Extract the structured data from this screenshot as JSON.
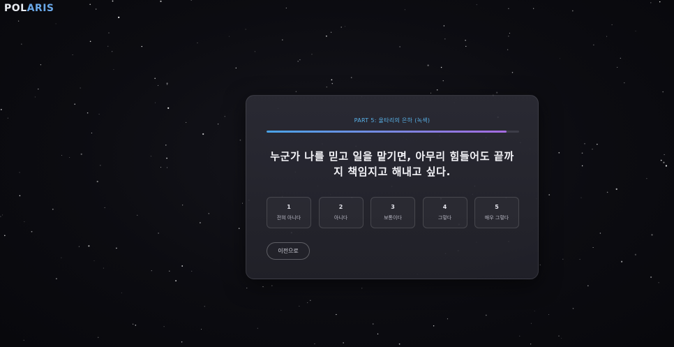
{
  "app": {
    "logo_main": "POL",
    "logo_accent": "ARIS"
  },
  "survey": {
    "part_label": "PART 5: 울타리의 은하 (녹색)",
    "progress_percent": 95,
    "question": "누군가 나를 믿고 일을 맡기면, 아무리 힘들어도 끝까지 책임지고 해내고 싶다.",
    "options": [
      {
        "number": "1",
        "label": "전혀 아니다"
      },
      {
        "number": "2",
        "label": "아니다"
      },
      {
        "number": "3",
        "label": "보통이다"
      },
      {
        "number": "4",
        "label": "그렇다"
      },
      {
        "number": "5",
        "label": "매우 그렇다"
      }
    ],
    "prev_label": "이전으로"
  },
  "colors": {
    "accent_blue": "#59b3ea",
    "progress_start": "#4aa3e6",
    "progress_end": "#a56be0",
    "background": "#0c0c11"
  }
}
